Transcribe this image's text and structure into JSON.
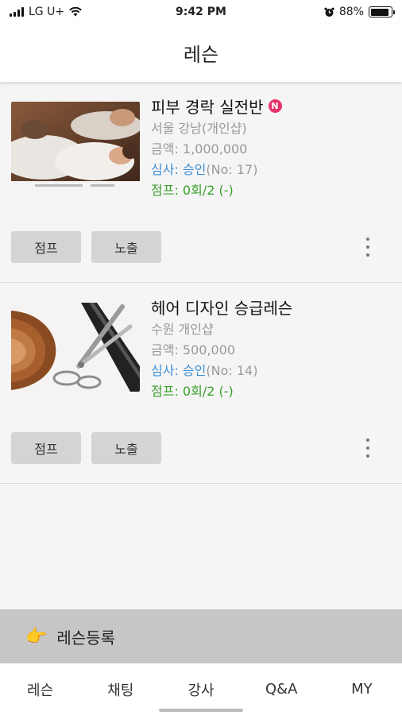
{
  "status_bar": {
    "carrier": "LG U+",
    "time": "9:42 PM",
    "battery": "88%",
    "battery_level": 0.88
  },
  "header": {
    "title": "레슨"
  },
  "lessons": [
    {
      "title": "피부 경락 실전반",
      "badge": "N",
      "location": "서울 강남(개인샵)",
      "price_label": "금액: ",
      "price": "1,000,000",
      "review_label": "심사: ",
      "review_status": "승인",
      "review_no": "(No: 17)",
      "jump": "점프: 0회/2 (-)",
      "jump_button": "점프",
      "expose_button": "노출"
    },
    {
      "title": "헤어 디자인 승급레슨",
      "location": "수원 개인샵",
      "price_label": "금액: ",
      "price": "500,000",
      "review_label": "심사: ",
      "review_status": "승인",
      "review_no": "(No: 14)",
      "jump": "점프: 0회/2 (-)",
      "jump_button": "점프",
      "expose_button": "노출"
    }
  ],
  "register": {
    "emoji": "👉",
    "label": "레슨등록"
  },
  "tabs": [
    "레슨",
    "채팅",
    "강사",
    "Q&A",
    "MY"
  ],
  "colors": {
    "accent_blue": "#3b8fd6",
    "accent_green": "#3aa02c",
    "badge_pink": "#e8336b"
  }
}
